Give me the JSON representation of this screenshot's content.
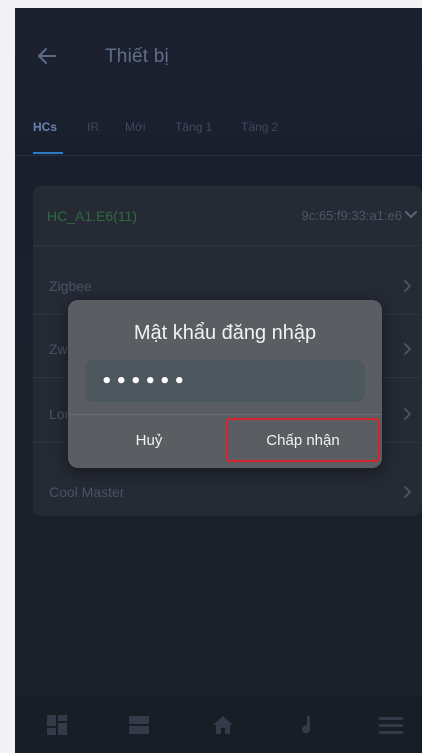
{
  "header": {
    "title": "Thiết bị"
  },
  "tabs": [
    {
      "label": "HCs",
      "active": true
    },
    {
      "label": "IR",
      "active": false
    },
    {
      "label": "Mới",
      "active": false
    },
    {
      "label": "Tầng 1",
      "active": false
    },
    {
      "label": "Tầng 2",
      "active": false
    }
  ],
  "hc": {
    "name": "HC_A1.E6(11)",
    "mac": "9c:65:f9:33:a1:e6"
  },
  "rows": [
    {
      "label": "Zigbee"
    },
    {
      "label": "Zwave"
    },
    {
      "label": "Lora"
    },
    {
      "label": "Cool Master"
    }
  ],
  "dialog": {
    "title": "Mật khẩu đăng nhập",
    "password_value": "••••••",
    "cancel_label": "Huỷ",
    "accept_label": "Chấp nhận"
  },
  "colors": {
    "accent": "#2c7ac8",
    "hc_name": "#2f6a3e",
    "highlight_border": "#d9232b"
  },
  "bottom_nav": [
    {
      "icon": "dashboard-icon"
    },
    {
      "icon": "devices-icon"
    },
    {
      "icon": "home-icon"
    },
    {
      "icon": "music-icon"
    },
    {
      "icon": "menu-icon"
    }
  ]
}
